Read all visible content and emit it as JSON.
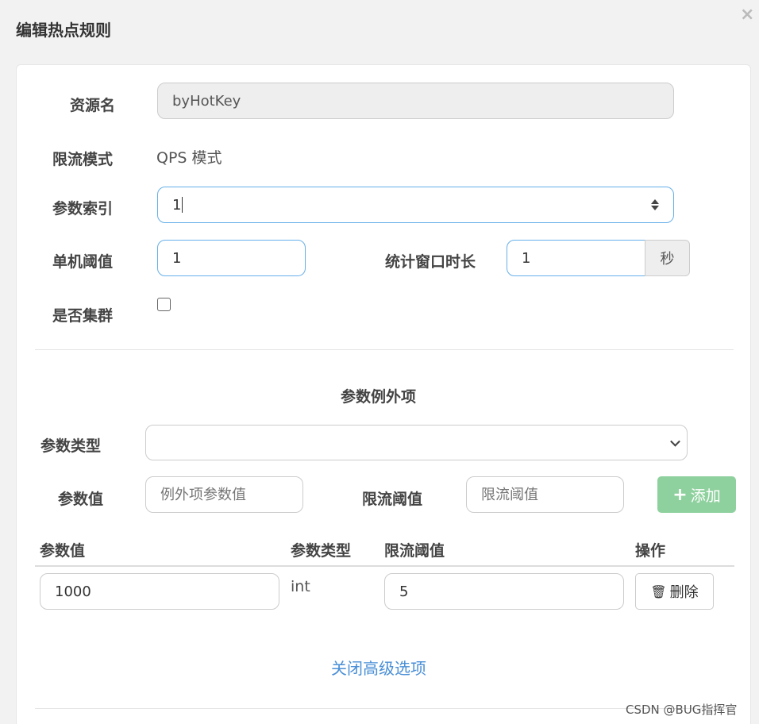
{
  "modal": {
    "title": "编辑热点规则",
    "close_symbol": "×"
  },
  "form": {
    "resource_label": "资源名",
    "resource_value": "byHotKey",
    "mode_label": "限流模式",
    "mode_value": "QPS 模式",
    "param_index_label": "参数索引",
    "param_index_value": "1",
    "threshold_label": "单机阈值",
    "threshold_value": "1",
    "window_label": "统计窗口时长",
    "window_value": "1",
    "window_unit": "秒",
    "cluster_label": "是否集群",
    "cluster_checked": false
  },
  "exceptions": {
    "section_title": "参数例外项",
    "type_label": "参数类型",
    "type_selected": "",
    "value_label": "参数值",
    "value_placeholder": "例外项参数值",
    "limit_label": "限流阈值",
    "limit_placeholder": "限流阈值",
    "add_label": "添加",
    "table": {
      "headers": [
        "参数值",
        "参数类型",
        "限流阈值",
        "操作"
      ],
      "rows": [
        {
          "value": "1000",
          "type": "int",
          "limit": "5",
          "action_label": "删除"
        }
      ]
    },
    "toggle_link": "关闭高级选项"
  },
  "watermark": "CSDN @BUG指挥官",
  "colors": {
    "focus_border": "#66afe9",
    "add_button": "#8fd19e",
    "link": "#4a8fd6"
  },
  "icons": [
    "close-icon",
    "spinner-icon",
    "chevron-down-icon",
    "plus-icon",
    "trash-icon"
  ]
}
